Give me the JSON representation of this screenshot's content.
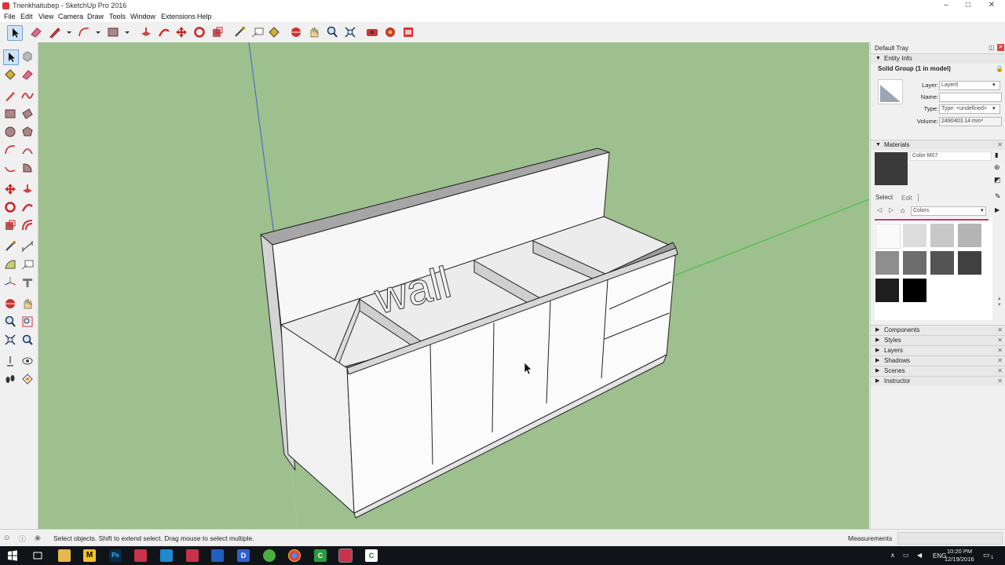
{
  "window": {
    "title": "Trienkhaitubep - SketchUp Pro 2016",
    "minimize": "–",
    "maximize": "□",
    "close": "✕"
  },
  "menu": [
    "File",
    "Edit",
    "View",
    "Camera",
    "Draw",
    "Tools",
    "Window",
    "Extensions",
    "Help"
  ],
  "model": {
    "wall_text": "wall"
  },
  "tray": {
    "title": "Default Tray",
    "entity_info": {
      "header": "Entity Info",
      "selection": "Solid Group (1 in model)",
      "layer_label": "Layer:",
      "layer_value": "Layer0",
      "name_label": "Name:",
      "name_value": "",
      "type_label": "Type:",
      "type_value": "Type: <undefined>",
      "volume_label": "Volume:",
      "volume_value": "2490403.14 mm³"
    },
    "materials": {
      "header": "Materials",
      "current_name": "Color M07",
      "current_color": "#3a3a3a",
      "tab_select": "Select",
      "tab_edit": "Edit",
      "library": "Colors",
      "swatches": [
        "#fafafa",
        "#dcdcdc",
        "#c8c8c8",
        "#b4b4b4",
        "#8e8e8e",
        "#6c6c6c",
        "#545454",
        "#404040",
        "#1e1e1e",
        "#000000"
      ]
    },
    "panels": [
      "Components",
      "Styles",
      "Layers",
      "Shadows",
      "Scenes",
      "Instructor"
    ]
  },
  "status": {
    "hint": "Select objects. Shift to extend select. Drag mouse to select multiple.",
    "measurements_label": "Measurements"
  },
  "taskbar": {
    "language": "ENG",
    "time": "10:20 PM",
    "date": "12/19/2016",
    "notification_count": "1"
  }
}
